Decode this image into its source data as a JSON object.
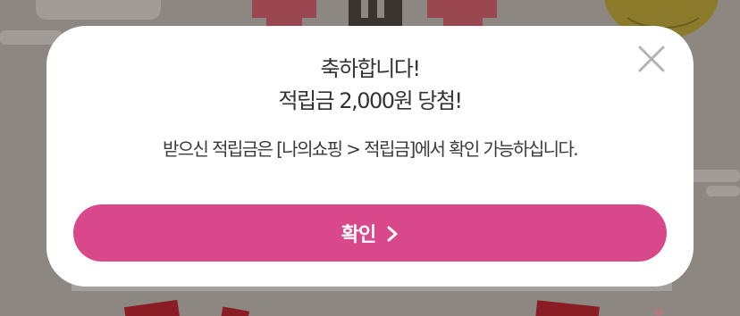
{
  "modal": {
    "headline_line1": "축하합니다!",
    "headline_line2": "적립금 2,000원 당첨!",
    "message": "받으신 적립금은 [나의쇼핑 > 적립금]에서 확인 가능하십니다.",
    "confirm_label": "확인",
    "confirm_icon": "chevron-right-icon",
    "close_icon": "close-icon"
  },
  "colors": {
    "accent": "#d9488a",
    "backdrop": "#8d8782",
    "modal_bg": "#ffffff",
    "text": "#333333"
  }
}
